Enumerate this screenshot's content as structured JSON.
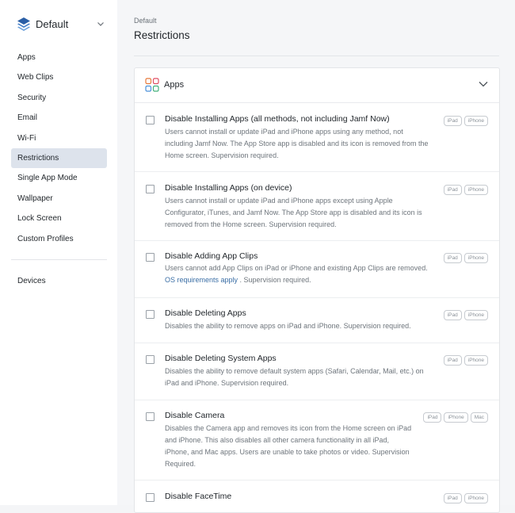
{
  "sidebar": {
    "profile_name": "Default",
    "items": [
      {
        "label": "Apps"
      },
      {
        "label": "Web Clips"
      },
      {
        "label": "Security"
      },
      {
        "label": "Email"
      },
      {
        "label": "Wi-Fi"
      },
      {
        "label": "Restrictions",
        "active": true
      },
      {
        "label": "Single App Mode"
      },
      {
        "label": "Wallpaper"
      },
      {
        "label": "Lock Screen"
      },
      {
        "label": "Custom Profiles"
      }
    ],
    "devices_label": "Devices"
  },
  "header": {
    "breadcrumb": "Default",
    "title": "Restrictions"
  },
  "section": {
    "title": "Apps"
  },
  "restrictions": [
    {
      "title": "Disable Installing Apps (all methods, not including Jamf Now)",
      "desc_lines": [
        "Users cannot install or update iPad and iPhone apps using any method, not",
        "including Jamf Now. The App Store app is disabled and its icon is removed from the",
        "Home screen. Supervision required."
      ],
      "platforms": [
        "iPad",
        "iPhone"
      ]
    },
    {
      "title": "Disable Installing Apps (on device)",
      "desc_lines": [
        "Users cannot install or update iPad and iPhone apps except using Apple",
        "Configurator, iTunes, and Jamf Now. The App Store app is disabled and its icon is",
        "removed from the Home screen. Supervision required."
      ],
      "platforms": [
        "iPad",
        "iPhone"
      ]
    },
    {
      "title": "Disable Adding App Clips",
      "desc_line1": "Users cannot add App Clips on iPad or iPhone and existing App Clips are removed.",
      "link_text": "OS requirements apply",
      "desc_after_link": " . Supervision required.",
      "platforms": [
        "iPad",
        "iPhone"
      ]
    },
    {
      "title": "Disable Deleting Apps",
      "desc_lines": [
        "Disables the ability to remove apps on iPad and iPhone. Supervision required."
      ],
      "platforms": [
        "iPad",
        "iPhone"
      ]
    },
    {
      "title": "Disable Deleting System Apps",
      "desc_lines": [
        "Disables the ability to remove default system apps (Safari, Calendar, Mail, etc.) on",
        "iPad and iPhone. Supervision required."
      ],
      "platforms": [
        "iPad",
        "iPhone"
      ]
    },
    {
      "title": "Disable Camera",
      "desc_lines": [
        "Disables the Camera app and removes its icon from the Home screen on iPad",
        "and iPhone. This also disables all other camera functionality in all iPad,",
        "iPhone, and Mac apps. Users are unable to take photos or video. Supervision",
        "Required."
      ],
      "platforms": [
        "iPad",
        "iPhone",
        "Mac"
      ]
    },
    {
      "title": "Disable FaceTime",
      "desc_lines": [],
      "platforms": [
        "iPad",
        "iPhone"
      ]
    }
  ],
  "colors": {
    "active_nav_bg": "#dde3ec",
    "link": "#3a6ea5",
    "app_icon_colors": [
      "#e8793a",
      "#e04f64",
      "#4a90d9",
      "#43b07a"
    ]
  }
}
